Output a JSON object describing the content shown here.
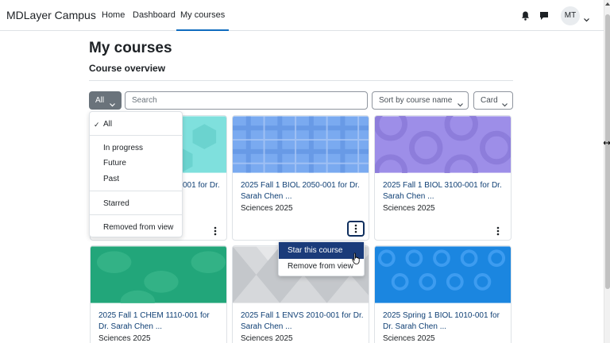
{
  "nav": {
    "brand": "MDLayer Campus",
    "links": [
      "Home",
      "Dashboard",
      "My courses"
    ],
    "avatar_initials": "MT"
  },
  "page": {
    "title": "My courses",
    "section": "Course overview"
  },
  "filters": {
    "grouping": "All",
    "search_placeholder": "Search",
    "sort": "Sort by course name",
    "view": "Card"
  },
  "grouping_menu": {
    "items": [
      "All",
      "In progress",
      "Future",
      "Past",
      "Starred",
      "Removed from view"
    ],
    "selected": "All"
  },
  "course_menu": {
    "star": "Star this course",
    "remove": "Remove from view"
  },
  "courses": [
    {
      "title": "2025 Fall 1 ...-001 for Dr.",
      "category": "",
      "color": "#7fe0dd"
    },
    {
      "title": "2025 Fall 1 BIOL 2050-001 for Dr. Sarah Chen ...",
      "category": "Sciences 2025",
      "color": "#7aaaf0"
    },
    {
      "title": "2025 Fall 1 BIOL 3100-001 for Dr. Sarah Chen ...",
      "category": "Sciences 2025",
      "color": "#9d8ee8"
    },
    {
      "title": "2025 Fall 1 CHEM 1110-001 for Dr. Sarah Chen ...",
      "category": "Sciences 2025",
      "color": "#22a67a"
    },
    {
      "title": "2025 Fall 1 ENVS 2010-001 for Dr. Sarah Chen ...",
      "category": "Sciences 2025",
      "color": "#d6d8db"
    },
    {
      "title": "2025 Spring 1 BIOL 1010-001 for Dr. Sarah Chen ...",
      "category": "Sciences 2025",
      "color": "#1b86e0"
    }
  ],
  "first_card_title_visible": "001 for Dr."
}
